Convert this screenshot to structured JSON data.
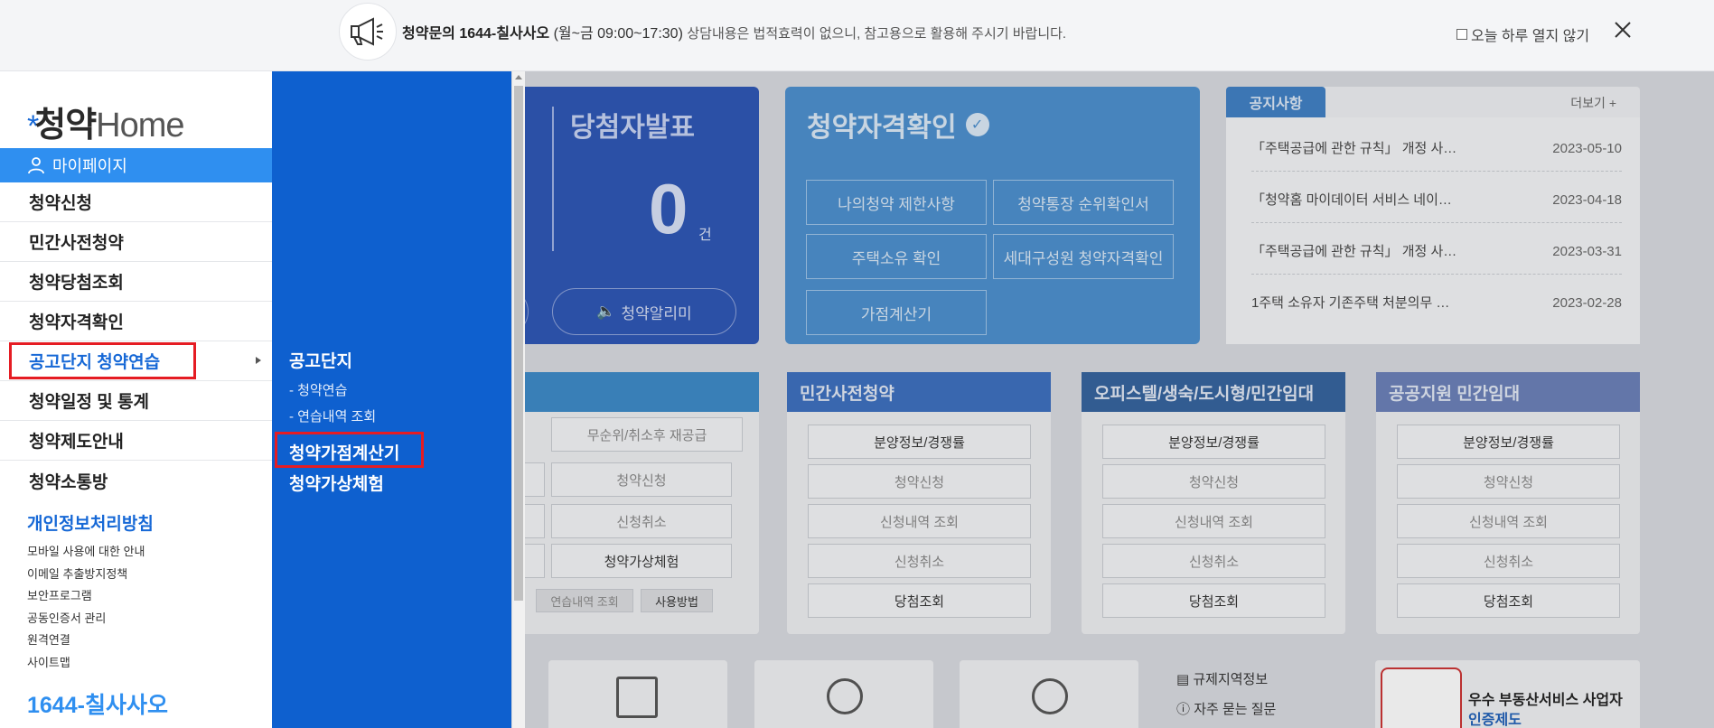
{
  "topbar": {
    "icon": "megaphone-icon",
    "notice_bold": "청약문의 1644-칠사사오",
    "notice_hours": "(월~금 09:00~17:30)",
    "notice_rest": "상담내용은 법적효력이 없으니, 참고용으로 활용해 주시기 바랍니다.",
    "skip_label": "오늘 하루 열지 않기",
    "close_icon": "close-icon"
  },
  "sidebar": {
    "logo_star": "*",
    "logo_cy": "청약",
    "logo_home": "Home",
    "mypage": "마이페이지",
    "items": [
      {
        "label": "청약신청"
      },
      {
        "label": "민간사전청약"
      },
      {
        "label": "청약당첨조회"
      },
      {
        "label": "청약자격확인"
      },
      {
        "label": "공고단지 청약연습"
      },
      {
        "label": "청약일정 및 통계"
      },
      {
        "label": "청약제도안내"
      },
      {
        "label": "청약소통방"
      }
    ],
    "privacy": "개인정보처리방침",
    "links": [
      "모바일 사용에 대한 안내",
      "이메일 추출방지정책",
      "보안프로그램",
      "공동인증서 관리",
      "원격연결",
      "사이트맵"
    ],
    "phone": "1644-칠사사오"
  },
  "submenu": {
    "section1": "공고단지",
    "link1": "- 청약연습",
    "link2": "- 연습내역 조회",
    "section2": "청약가점계산기",
    "section3": "청약가상체험"
  },
  "background": {
    "winners_title": "당첨자발표",
    "winners_count": "0",
    "winners_unit": "건",
    "alarm_label": "청약알리미",
    "qual_title": "청약자격확인",
    "qual_buttons": [
      "나의청약 제한사항",
      "청약통장 순위확인서",
      "주택소유 확인",
      "세대구성원 청약자격확인",
      "가점계산기"
    ],
    "notice_tab": "공지사항",
    "notice_more": "더보기",
    "notices": [
      {
        "title": "「주택공급에 관한 규칙」 개정 사…",
        "date": "2023-05-10"
      },
      {
        "title": "「청약홈 마이데이터 서비스 네이…",
        "date": "2023-04-18"
      },
      {
        "title": "「주택공급에 관한 규칙」 개정 사…",
        "date": "2023-03-31"
      },
      {
        "title": "1주택 소유자 기존주택 처분의무 …",
        "date": "2023-02-28"
      }
    ],
    "card1_cells": [
      "무순위/취소후 재공급",
      "청약신청",
      "신청취소",
      "청약가상체험",
      "연습내역 조회",
      "사용방법"
    ],
    "card2_title": "민간사전청약",
    "card3_title": "오피스텔/생숙/도시형/민간임대",
    "card4_title": "공공지원 민간임대",
    "card_cells": [
      "분양정보/경쟁률",
      "청약신청",
      "신청내역 조회",
      "신청취소",
      "당첨조회"
    ],
    "bottom_links": [
      "규제지역정보",
      "자주 묻는 질문"
    ],
    "award_line1": "우수 부동산서비스 사업자",
    "award_line2": "인증제도"
  },
  "colors": {
    "brand_blue": "#0e60cf",
    "mypage_blue": "#2f8ff0",
    "highlight_red": "#e51c23"
  }
}
